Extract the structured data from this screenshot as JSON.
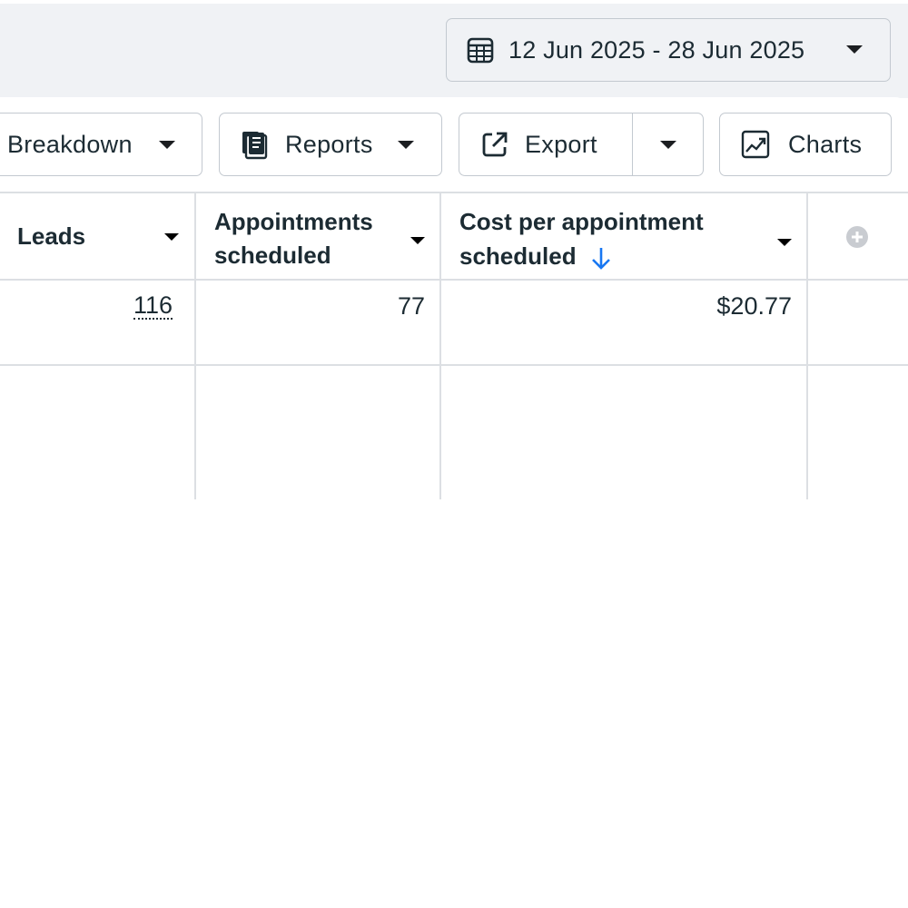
{
  "date_range": {
    "label": "12 Jun 2025 - 28 Jun 2025",
    "icon": "calendar-icon"
  },
  "toolbar": {
    "breakdown_label": "Breakdown",
    "reports_label": "Reports",
    "export_label": "Export",
    "charts_label": "Charts",
    "icons": [
      "reports-icon",
      "export-icon",
      "charts-icon"
    ]
  },
  "table": {
    "columns": [
      {
        "label": "Leads"
      },
      {
        "label_line1": "Appointments",
        "label_line2": "scheduled"
      },
      {
        "label_line1": "Cost per appointment",
        "label_line2": "scheduled",
        "sort": "descending"
      }
    ],
    "rows": [
      {
        "leads": "116",
        "appointments": "77",
        "cost": "$20.77"
      }
    ]
  },
  "colors": {
    "accent": "#1877f2",
    "text": "#1c2b33",
    "border": "#c3c9d0",
    "header_bg": "#f0f2f5"
  }
}
